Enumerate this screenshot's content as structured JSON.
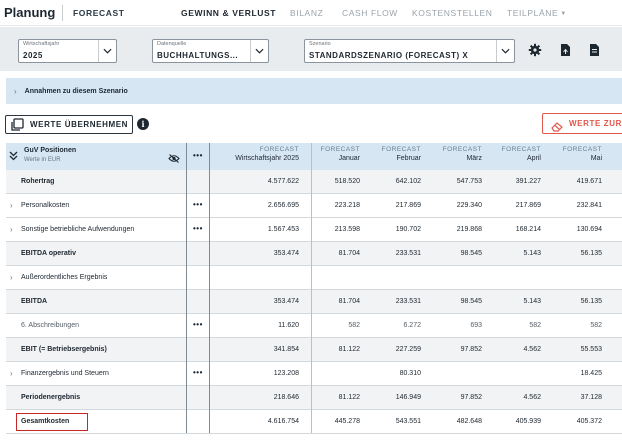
{
  "nav": {
    "brand": "Planung",
    "forecast": "FORECAST",
    "items": [
      "GEWINN & VERLUST",
      "BILANZ",
      "CASH FLOW",
      "KOSTENSTELLEN",
      "TEILPLÄNE"
    ],
    "active_index": 0
  },
  "toolbar": {
    "year": {
      "label": "Wirtschaftsjahr",
      "value": "2025"
    },
    "source": {
      "label": "Datenquelle",
      "value": "BUCHHALTUNGS..."
    },
    "scenario": {
      "label": "Szenario",
      "value": "STANDARDSZENARIO (FORECAST) X"
    },
    "icons": [
      "gear-icon",
      "export-file-icon",
      "download-file-icon"
    ]
  },
  "assumptions": {
    "text": "Annahmen zu diesem Szenario"
  },
  "buttons": {
    "apply": "WERTE ÜBERNEHMEN",
    "reset": "WERTE ZURÜ"
  },
  "table": {
    "header": {
      "title": "GuV Positionen",
      "subtitle": "Werte in EUR",
      "dots": "•••",
      "total_top": "FORECAST",
      "total_bottom": "Wirtschaftsjahr 2025",
      "months": [
        {
          "top": "FORECAST",
          "bottom": "Januar"
        },
        {
          "top": "FORECAST",
          "bottom": "Februar"
        },
        {
          "top": "FORECAST",
          "bottom": "März"
        },
        {
          "top": "FORECAST",
          "bottom": "April"
        },
        {
          "top": "FORECAST",
          "bottom": "Mai"
        }
      ]
    },
    "rows": [
      {
        "label": "Rohertrag",
        "bold": true,
        "expandable": false,
        "dots": "",
        "total": "4.577.622",
        "values": [
          "518.520",
          "642.102",
          "547.753",
          "391.227",
          "419.671"
        ]
      },
      {
        "label": "Personalkosten",
        "bold": false,
        "expandable": true,
        "dots": "•••",
        "total": "2.656.695",
        "values": [
          "223.218",
          "217.869",
          "229.340",
          "217.869",
          "232.841"
        ]
      },
      {
        "label": "Sonstige betriebliche Aufwendungen",
        "bold": false,
        "expandable": true,
        "dots": "•••",
        "total": "1.567.453",
        "values": [
          "213.598",
          "190.702",
          "219.868",
          "168.214",
          "130.694"
        ]
      },
      {
        "label": "EBITDA operativ",
        "bold": true,
        "expandable": false,
        "dots": "",
        "total": "353.474",
        "values": [
          "81.704",
          "233.531",
          "98.545",
          "5.143",
          "56.135"
        ]
      },
      {
        "label": "Außerordentliches Ergebnis",
        "bold": false,
        "expandable": true,
        "dots": "",
        "total": "",
        "values": [
          "",
          "",
          "",
          "",
          ""
        ]
      },
      {
        "label": "EBITDA",
        "bold": true,
        "expandable": false,
        "dots": "",
        "total": "353.474",
        "values": [
          "81.704",
          "233.531",
          "98.545",
          "5.143",
          "56.135"
        ]
      },
      {
        "label": "6. Abschreibungen",
        "bold": false,
        "light": true,
        "expandable": false,
        "dots": "•••",
        "total": "11.620",
        "values": [
          "582",
          "6.272",
          "693",
          "582",
          "582"
        ]
      },
      {
        "label": "EBIT (= Betriebsergebnis)",
        "bold": true,
        "expandable": false,
        "dots": "",
        "total": "341.854",
        "values": [
          "81.122",
          "227.259",
          "97.852",
          "4.562",
          "55.553"
        ]
      },
      {
        "label": "Finanzergebnis und Steuern",
        "bold": false,
        "expandable": true,
        "dots": "•••",
        "total": "123.208",
        "values": [
          "",
          "80.310",
          "",
          "",
          "18.425"
        ]
      },
      {
        "label": "Periodenergebnis",
        "bold": true,
        "expandable": false,
        "dots": "",
        "total": "218.646",
        "values": [
          "81.122",
          "146.949",
          "97.852",
          "4.562",
          "37.128"
        ]
      },
      {
        "label": "Gesamtkosten",
        "bold": true,
        "expandable": false,
        "dots": "",
        "highlight": true,
        "total": "4.616.754",
        "values": [
          "445.278",
          "543.551",
          "482.648",
          "405.939",
          "405.372"
        ]
      }
    ]
  },
  "colors": {
    "accent_red": "#e2574c",
    "header_blue": "#d6e6f3",
    "highlight_box": "#c62828"
  }
}
